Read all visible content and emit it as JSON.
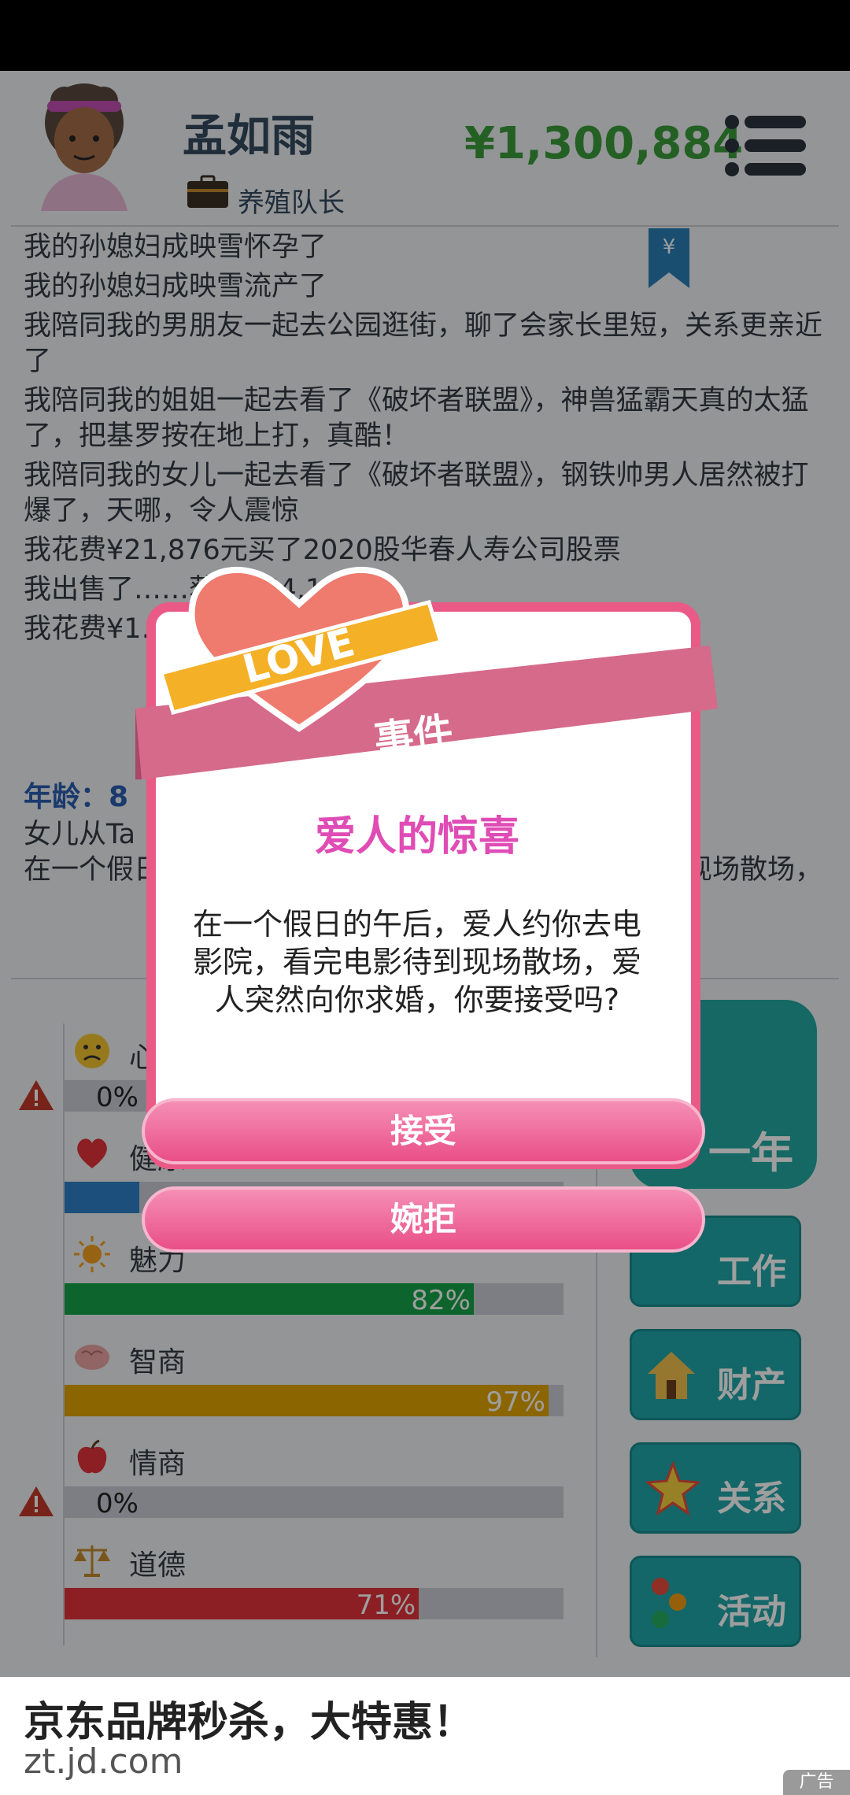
{
  "header": {
    "player_name": "孟如雨",
    "job": "养殖队长",
    "money": "¥1,300,884"
  },
  "log": [
    "我的孙媳妇成映雪怀孕了",
    "我的孙媳妇成映雪流产了",
    "我陪同我的男朋友一起去公园逛街，聊了会家长里短，关系更亲近了",
    "我陪同我的姐姐一起去看了《破坏者联盟》，神兽猛霸天真的太猛了，把基罗按在地上打，真酷！",
    "我陪同我的女儿一起去看了《破坏者联盟》，钢铁帅男人居然被打爆了，天哪，令人震惊",
    "我花费¥21,876元买了2020股华春人寿公司股票",
    "我出售了……获得¥64,116元",
    "我花费¥1……股票"
  ],
  "age_section": {
    "age_label": "年龄：8",
    "line1": "女儿从Ta",
    "line2": "在一个假日的午后，爱人约你去电影院，看完电影待到现场散场，"
  },
  "stats": [
    {
      "label": "心情",
      "percent": 0,
      "text": "0%",
      "color": "#2f80c8",
      "warn": true,
      "icon": "sad-face-icon"
    },
    {
      "label": "健康",
      "percent": 15,
      "text": "",
      "color": "#2f80c8",
      "warn": false,
      "icon": "heart-icon"
    },
    {
      "label": "魅力",
      "percent": 82,
      "text": "82%",
      "color": "#16a34a",
      "warn": false,
      "icon": "sun-icon"
    },
    {
      "label": "智商",
      "percent": 97,
      "text": "97%",
      "color": "#e0a400",
      "warn": false,
      "icon": "brain-icon"
    },
    {
      "label": "情商",
      "percent": 0,
      "text": "0%",
      "color": "#2f80c8",
      "warn": true,
      "icon": "apple-icon"
    },
    {
      "label": "道德",
      "percent": 71,
      "text": "71%",
      "color": "#e0323a",
      "warn": false,
      "icon": "scales-icon"
    }
  ],
  "side": {
    "next_year": "一年",
    "work": "工作",
    "property": "财产",
    "relations": "关系",
    "activities": "活动"
  },
  "dialog": {
    "ribbon_label": "事件",
    "badge": "LOVE",
    "title": "爱人的惊喜",
    "body": "在一个假日的午后，爱人约你去电影院，看完电影待到现场散场，爱人突然向你求婚，你要接受吗?",
    "accept": "接受",
    "decline": "婉拒"
  },
  "ad": {
    "title": "京东品牌秒杀，大特惠！",
    "url": "zt.jd.com",
    "badge": "广告"
  }
}
